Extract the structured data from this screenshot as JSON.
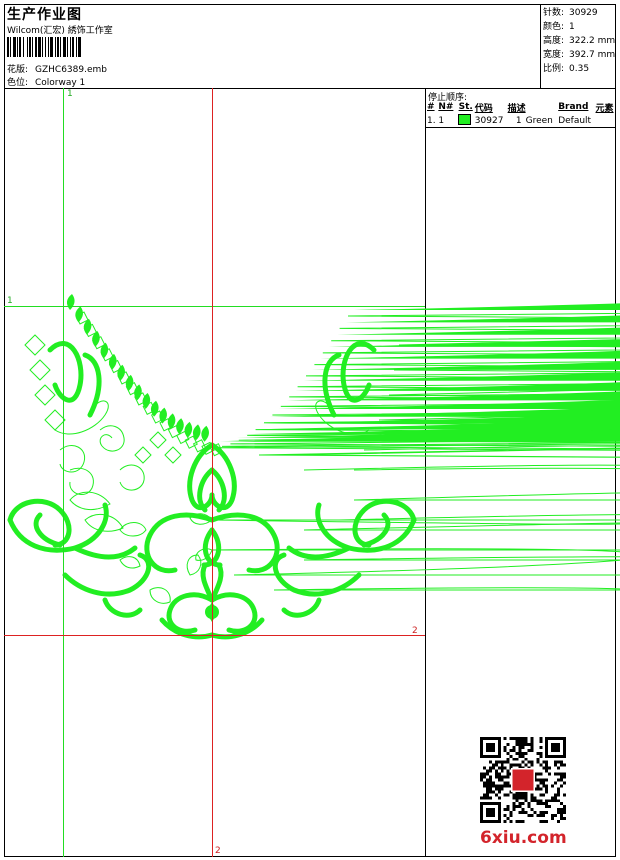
{
  "header": {
    "title": "生产作业图",
    "subtitle": "Wilcom(汇宏) 綉饰工作室",
    "design_label": "花版:",
    "design_value": "GZHC6389.emb",
    "colorway_label": "色位:",
    "colorway_value": "Colorway 1"
  },
  "stats": [
    {
      "label": "针数:",
      "value": "30929"
    },
    {
      "label": "颜色:",
      "value": "1"
    },
    {
      "label": "高度:",
      "value": "322.2 mm"
    },
    {
      "label": "宽度:",
      "value": "392.7 mm"
    },
    {
      "label": "比例:",
      "value": "0.35"
    }
  ],
  "stop_sequence": {
    "title": "停止顺序:",
    "headers": [
      "#",
      "N#",
      "St.",
      "代码",
      "描述",
      "Brand",
      "元素"
    ],
    "rows": [
      {
        "index": "1.",
        "needle": "1",
        "color": "#22ee22",
        "stitches": "30927",
        "code": "1",
        "description": "Green",
        "brand": "Default",
        "element": ""
      }
    ]
  },
  "guides": {
    "green_v_label": "1",
    "green_h_label": "1",
    "red_h_label": "2",
    "red_v_label": "2",
    "green_color": "#22dd22",
    "red_color": "#dd2222"
  },
  "design_color": "#22ee22",
  "watermark": "6xiu.com"
}
